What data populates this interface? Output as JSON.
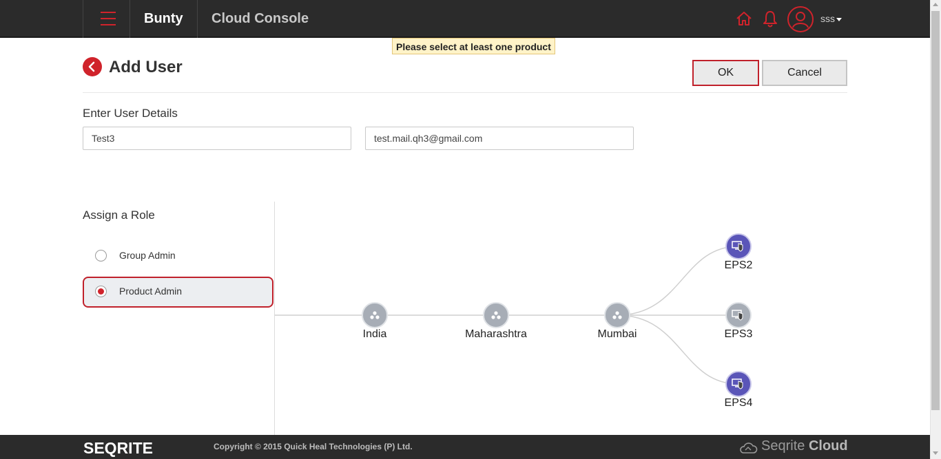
{
  "header": {
    "brand": "Bunty",
    "title": "Cloud Console",
    "username": "sss",
    "icons": [
      "menu-icon",
      "home-icon",
      "bell-icon",
      "user-icon"
    ],
    "accent_color": "#d0232b"
  },
  "tooltip": {
    "text": "Please select at least one product"
  },
  "page": {
    "title": "Add User",
    "ok_label": "OK",
    "cancel_label": "Cancel"
  },
  "user_details": {
    "heading": "Enter User Details",
    "name_value": "Test3",
    "email_value": "test.mail.qh3@gmail.com"
  },
  "roles": {
    "heading": "Assign a Role",
    "items": [
      {
        "label": "Group Admin",
        "selected": false
      },
      {
        "label": "Product Admin",
        "selected": true
      }
    ]
  },
  "tree": {
    "nodes": {
      "country": "India",
      "state": "Maharashtra",
      "city": "Mumbai"
    },
    "products": [
      {
        "label": "EPS2",
        "active": true
      },
      {
        "label": "EPS3",
        "active": false
      },
      {
        "label": "EPS4",
        "active": true
      }
    ]
  },
  "footer": {
    "logo": "SEQRITE",
    "copyright": "Copyright © 2015 Quick Heal Technologies (P) Ltd.",
    "cloud_brand_light": "Seqrite ",
    "cloud_brand_bold": "Cloud"
  }
}
